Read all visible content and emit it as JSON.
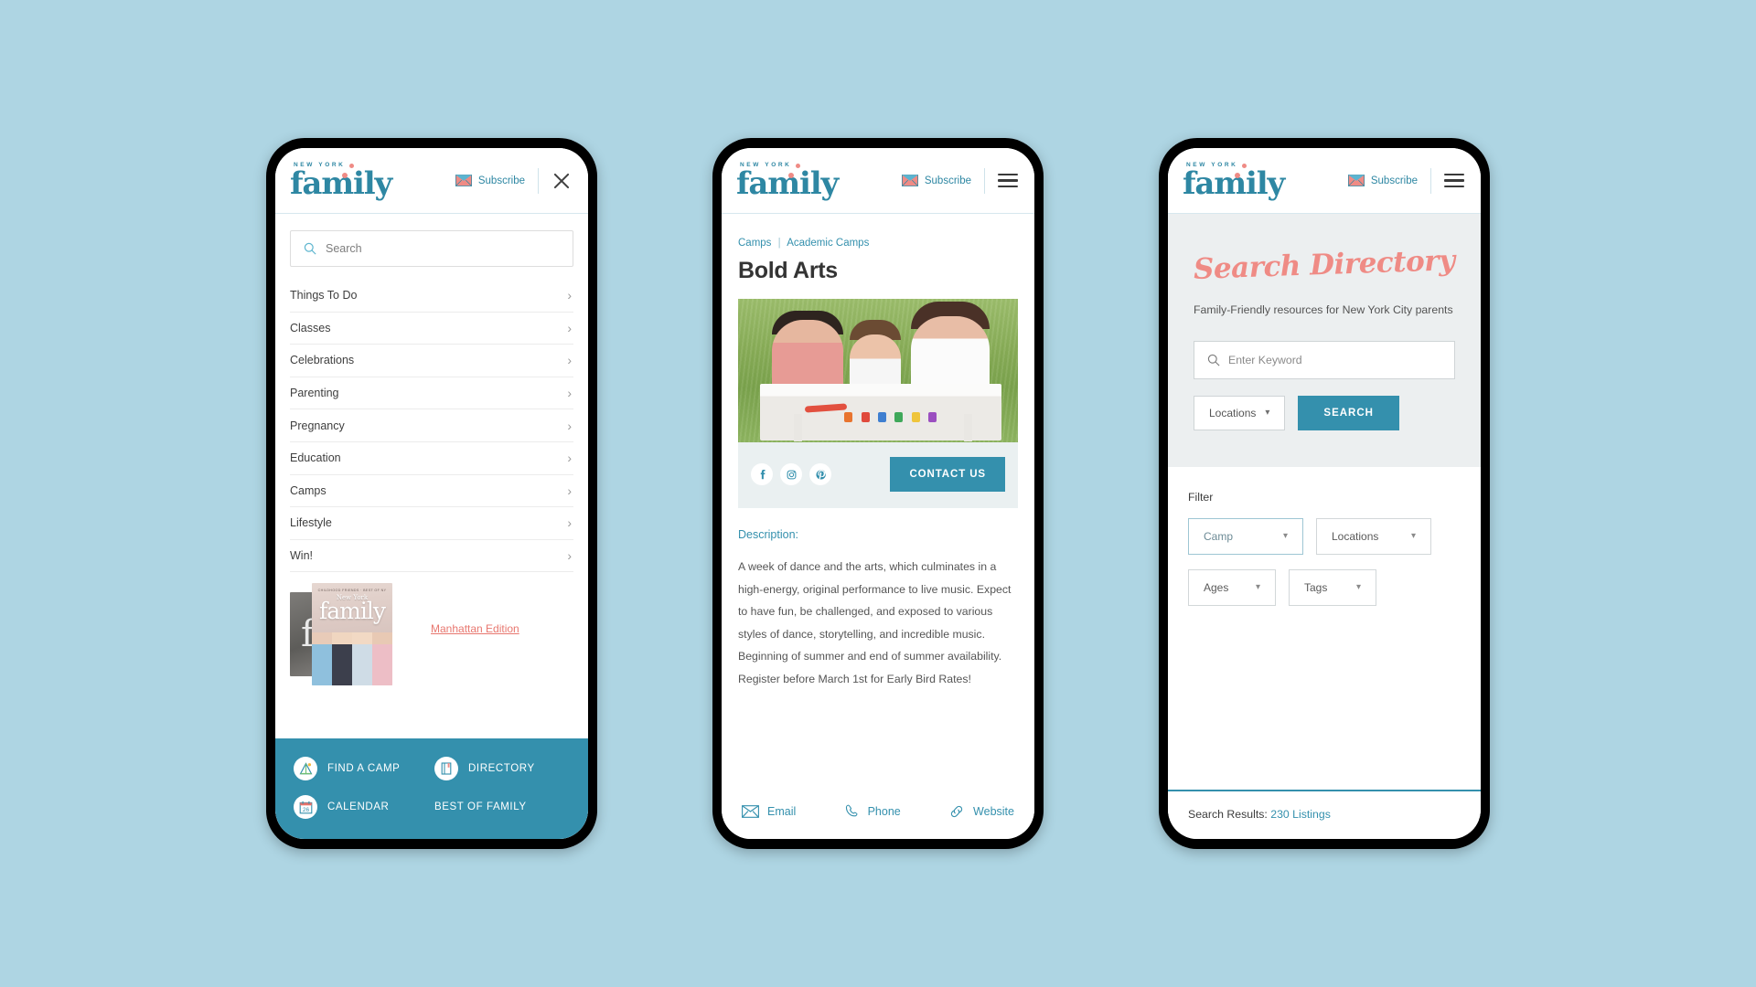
{
  "background_color": "#aed5e3",
  "brand": {
    "kicker": "NEW YORK",
    "word": "family",
    "teal": "#3490ad",
    "coral": "#ef8b85"
  },
  "phone1": {
    "header": {
      "subscribe_label": "Subscribe",
      "envelope_icon": "envelope-icon",
      "close_icon": "close-icon"
    },
    "search": {
      "placeholder": "Search",
      "value": "",
      "icon": "search-icon"
    },
    "nav_items": [
      {
        "label": "Things To Do",
        "chevron": "›"
      },
      {
        "label": "Classes",
        "chevron": "›"
      },
      {
        "label": "Celebrations",
        "chevron": "›"
      },
      {
        "label": "Parenting",
        "chevron": "›"
      },
      {
        "label": "Pregnancy",
        "chevron": "›"
      },
      {
        "label": "Education",
        "chevron": "›"
      },
      {
        "label": "Camps",
        "chevron": "›"
      },
      {
        "label": "Lifestyle",
        "chevron": "›"
      },
      {
        "label": "Win!",
        "chevron": "›"
      }
    ],
    "promo": {
      "cover_kicker": "CHILDHOOD FRIENDS · BEST OF NY",
      "cover_city": "New York",
      "cover_word": "family",
      "edition_link": "Manhattan Edition"
    },
    "quicklinks": [
      {
        "label": "FIND A CAMP",
        "icon": "tent-icon"
      },
      {
        "label": "DIRECTORY",
        "icon": "book-icon"
      },
      {
        "label": "CALENDAR",
        "icon": "calendar-icon",
        "calendar_day": "26"
      },
      {
        "label": "BEST OF FAMILY",
        "icon": "none"
      }
    ]
  },
  "phone2": {
    "header": {
      "subscribe_label": "Subscribe",
      "envelope_icon": "envelope-icon",
      "menu_icon": "hamburger-icon"
    },
    "breadcrumb": {
      "parent": "Camps",
      "separator": "|",
      "current": "Academic Camps"
    },
    "title": "Bold Arts",
    "hero_alt": "family finger painting at a white table on grass",
    "socials": [
      {
        "name": "facebook-icon",
        "glyph": "f"
      },
      {
        "name": "instagram-icon",
        "glyph": "▣"
      },
      {
        "name": "pinterest-icon",
        "glyph": "P"
      }
    ],
    "contact_button": "CONTACT US",
    "description_label": "Description:",
    "description": "A week of dance and the arts, which culminates in a high-energy, original performance to live music. Expect to have fun, be challenged, and exposed to various styles of dance, storytelling, and incredible music. Beginning of summer and end of summer availability. Register before March 1st for Early Bird Rates!",
    "contact_links": [
      {
        "label": "Email",
        "icon": "email-icon"
      },
      {
        "label": "Phone",
        "icon": "phone-icon"
      },
      {
        "label": "Website",
        "icon": "link-icon"
      }
    ]
  },
  "phone3": {
    "header": {
      "subscribe_label": "Subscribe",
      "envelope_icon": "envelope-icon",
      "menu_icon": "hamburger-icon"
    },
    "hero": {
      "title": "Search Directory",
      "subtitle": "Family-Friendly resources for New York City parents",
      "keyword_placeholder": "Enter Keyword",
      "keyword_value": "",
      "search_icon": "search-icon",
      "locations_label": "Locations",
      "search_button": "SEARCH"
    },
    "filter": {
      "label": "Filter",
      "selects": [
        {
          "label": "Camp",
          "active": true
        },
        {
          "label": "Locations",
          "active": false
        },
        {
          "label": "Ages",
          "active": false
        },
        {
          "label": "Tags",
          "active": false
        }
      ]
    },
    "results": {
      "label": "Search Results:",
      "count": "230 Listings"
    }
  }
}
